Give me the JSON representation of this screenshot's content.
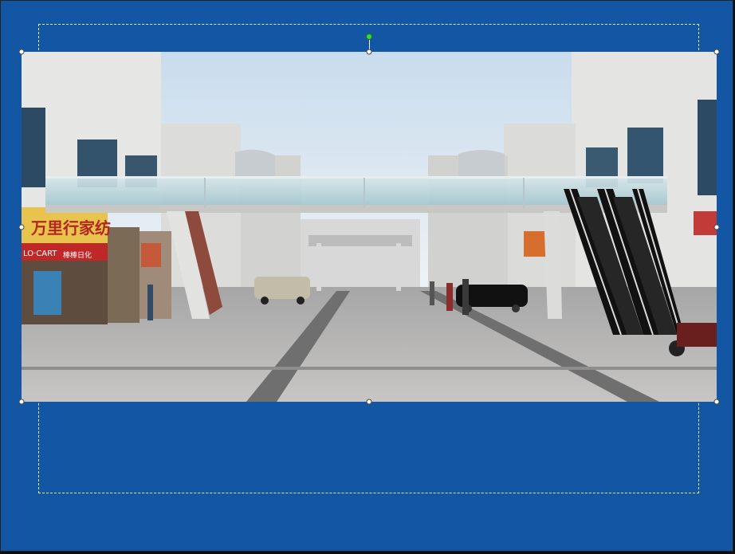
{
  "slide": {
    "background_color": "#1356a4",
    "selection_handle_color": "#ffffff",
    "rotation_handle_color": "#33dd33"
  },
  "picture": {
    "description_icon": "photo-icon",
    "signs": {
      "shop_sign_main": "万里行家纺",
      "shop_sign_left": "LO·CART",
      "shop_sign_small": "棒棒日化"
    }
  }
}
